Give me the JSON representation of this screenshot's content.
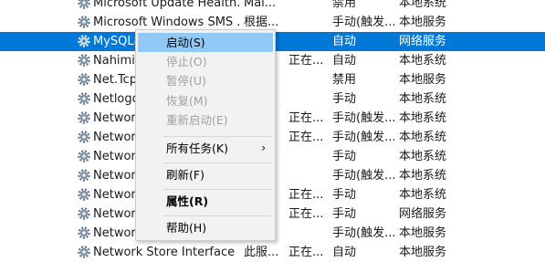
{
  "services": [
    {
      "name": "Microsoft Update Health...",
      "desc": "Mai...",
      "status": "",
      "startup": "禁用",
      "logon": "本地系统"
    },
    {
      "name": "Microsoft Windows SMS ...",
      "desc": "根据...",
      "status": "",
      "startup": "手动(触发...",
      "logon": "本地服务"
    },
    {
      "name": "MySQL8",
      "desc": "",
      "status": "",
      "startup": "自动",
      "logon": "网络服务",
      "selected": true
    },
    {
      "name": "Nahimic",
      "desc": "",
      "status": "正在...",
      "startup": "自动",
      "logon": "本地系统"
    },
    {
      "name": "Net.Tcp",
      "desc": "",
      "status": "",
      "startup": "禁用",
      "logon": "本地服务"
    },
    {
      "name": "Netlogo",
      "desc": "",
      "status": "",
      "startup": "手动",
      "logon": "本地系统"
    },
    {
      "name": "Network",
      "desc": "",
      "status": "正在...",
      "startup": "手动(触发...",
      "logon": "本地系统"
    },
    {
      "name": "Network",
      "desc": "",
      "status": "正在...",
      "startup": "手动(触发...",
      "logon": "本地系统"
    },
    {
      "name": "Network",
      "desc": "",
      "status": "",
      "startup": "手动",
      "logon": "本地系统"
    },
    {
      "name": "Network",
      "desc": "",
      "status": "",
      "startup": "手动(触发...",
      "logon": "本地系统"
    },
    {
      "name": "Network",
      "desc": "",
      "status": "正在...",
      "startup": "手动",
      "logon": "本地系统"
    },
    {
      "name": "Network",
      "desc": "",
      "status": "正在...",
      "startup": "手动",
      "logon": "网络服务"
    },
    {
      "name": "Network",
      "desc": "",
      "status": "",
      "startup": "手动(触发...",
      "logon": "本地服务"
    },
    {
      "name": "Network Store Interface ...",
      "desc": "此服...",
      "status": "正在...",
      "startup": "自动",
      "logon": "本地服务"
    }
  ],
  "context_menu": {
    "start": "启动(S)",
    "stop": "停止(O)",
    "pause": "暂停(U)",
    "resume": "恢复(M)",
    "restart": "重新启动(E)",
    "all_tasks": "所有任务(K)",
    "all_tasks_arrow": "›",
    "refresh": "刷新(F)",
    "properties": "属性(R)",
    "help": "帮助(H)"
  },
  "icons": {
    "service": "gear-icon",
    "submenu": "chevron-right-icon"
  },
  "colors": {
    "selection": "#0078d7",
    "menu_hover": "#91c9f7",
    "menu_background": "#f2f2f2",
    "disabled_text": "#a0a0a0"
  }
}
